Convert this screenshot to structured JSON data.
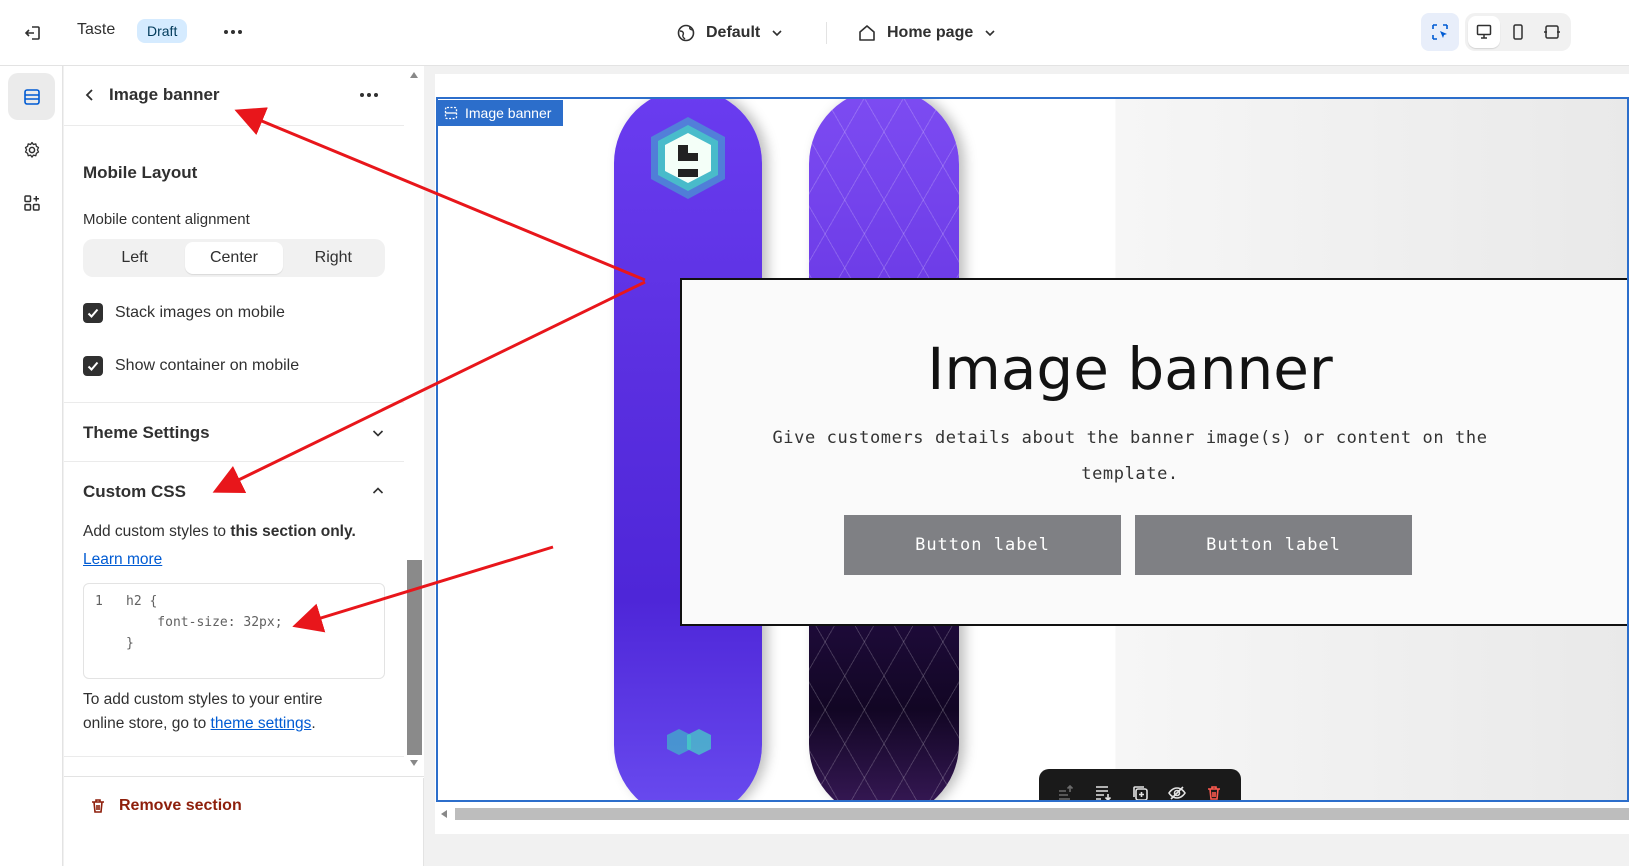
{
  "topbar": {
    "theme_name": "Taste",
    "status_badge": "Draft",
    "template_dropdown": "Default",
    "page_dropdown": "Home page"
  },
  "sidebar": {
    "title": "Image banner",
    "mobile_layout": {
      "heading": "Mobile Layout",
      "alignment_label": "Mobile content alignment",
      "options": [
        "Left",
        "Center",
        "Right"
      ],
      "selected": "Center",
      "stack_images_label": "Stack images on mobile",
      "stack_images_checked": true,
      "show_container_label": "Show container on mobile",
      "show_container_checked": true
    },
    "theme_settings": {
      "heading": "Theme Settings"
    },
    "custom_css": {
      "heading": "Custom CSS",
      "help_prefix": "Add custom styles to ",
      "help_bold": "this section only.",
      "learn_more": "Learn more",
      "code_line_number": "1",
      "code_lines": [
        "h2 {",
        "    font-size: 32px;",
        "}"
      ],
      "footer_prefix_1": "To add custom styles to your entire",
      "footer_prefix_2": "online store, go to ",
      "footer_link": "theme settings",
      "footer_suffix": "."
    },
    "remove_section": "Remove section"
  },
  "preview": {
    "section_tag": "Image banner",
    "banner_heading": "Image banner",
    "banner_text": "Give customers details about the banner image(s) or content on the template.",
    "button_1": "Button label",
    "button_2": "Button label"
  },
  "colors": {
    "accent_blue": "#2c6ecb",
    "link_blue": "#005bd3",
    "remove_red": "#8e1f0b",
    "annotation_red": "#e8161b",
    "button_grey": "#7f8084"
  }
}
